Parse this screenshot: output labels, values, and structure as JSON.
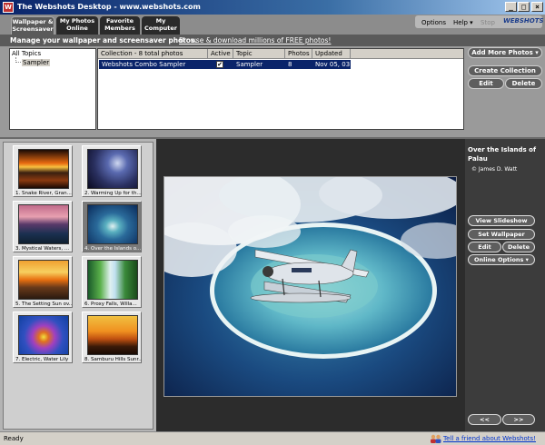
{
  "window": {
    "title": "The Webshots Desktop - www.webshots.com",
    "minimize": "_",
    "restore": "□",
    "close": "×"
  },
  "tabs": [
    {
      "line1": "Wallpaper &",
      "line2": "Screensaver"
    },
    {
      "line1": "My Photos",
      "line2": "Online"
    },
    {
      "line1": "Favorite",
      "line2": "Members"
    },
    {
      "line1": "My",
      "line2": "Computer"
    }
  ],
  "menu": {
    "options": "Options",
    "help": "Help ▾",
    "stop": "Stop",
    "logo": "WEBSHOTS"
  },
  "manage": {
    "text": "Manage your wallpaper and screensaver photos.",
    "link": "Browse & download millions of FREE photos!"
  },
  "tree": {
    "root": "All Topics",
    "child": "Sampler"
  },
  "grid": {
    "headers": [
      "Collection - 8 total photos",
      "Active",
      "Topic",
      "Photos",
      "Updated"
    ],
    "rows": [
      {
        "collection": "Webshots Combo Sampler",
        "active": "✔",
        "topic": "Sampler",
        "photos": "8",
        "updated": "Nov 05, 03"
      }
    ]
  },
  "collection_buttons": {
    "add_more": "Add More Photos ▾",
    "create": "Create Collection",
    "edit": "Edit",
    "delete": "Delete"
  },
  "thumbnails": [
    {
      "caption": "1. Snake River, Gran..."
    },
    {
      "caption": "2. Warming Up for th..."
    },
    {
      "caption": "3. Mystical Waters, ..."
    },
    {
      "caption": "4. Over the Islands o..."
    },
    {
      "caption": "5. The Setting Sun ov..."
    },
    {
      "caption": "6. Proxy Falls, Willa..."
    },
    {
      "caption": "7. Electric, Water Lily"
    },
    {
      "caption": "8. Samburu Hills Sunr..."
    }
  ],
  "photo_info": {
    "title": "Over the Islands of Palau",
    "credit": "© James D. Watt"
  },
  "photo_buttons": {
    "slideshow": "View Slideshow",
    "wallpaper": "Set Wallpaper",
    "edit": "Edit",
    "delete": "Delete",
    "online": "Online Options ▾",
    "prev": "<<",
    "next": ">>"
  },
  "status": {
    "text": "Ready",
    "tell": "Tell a friend about Webshots!"
  }
}
